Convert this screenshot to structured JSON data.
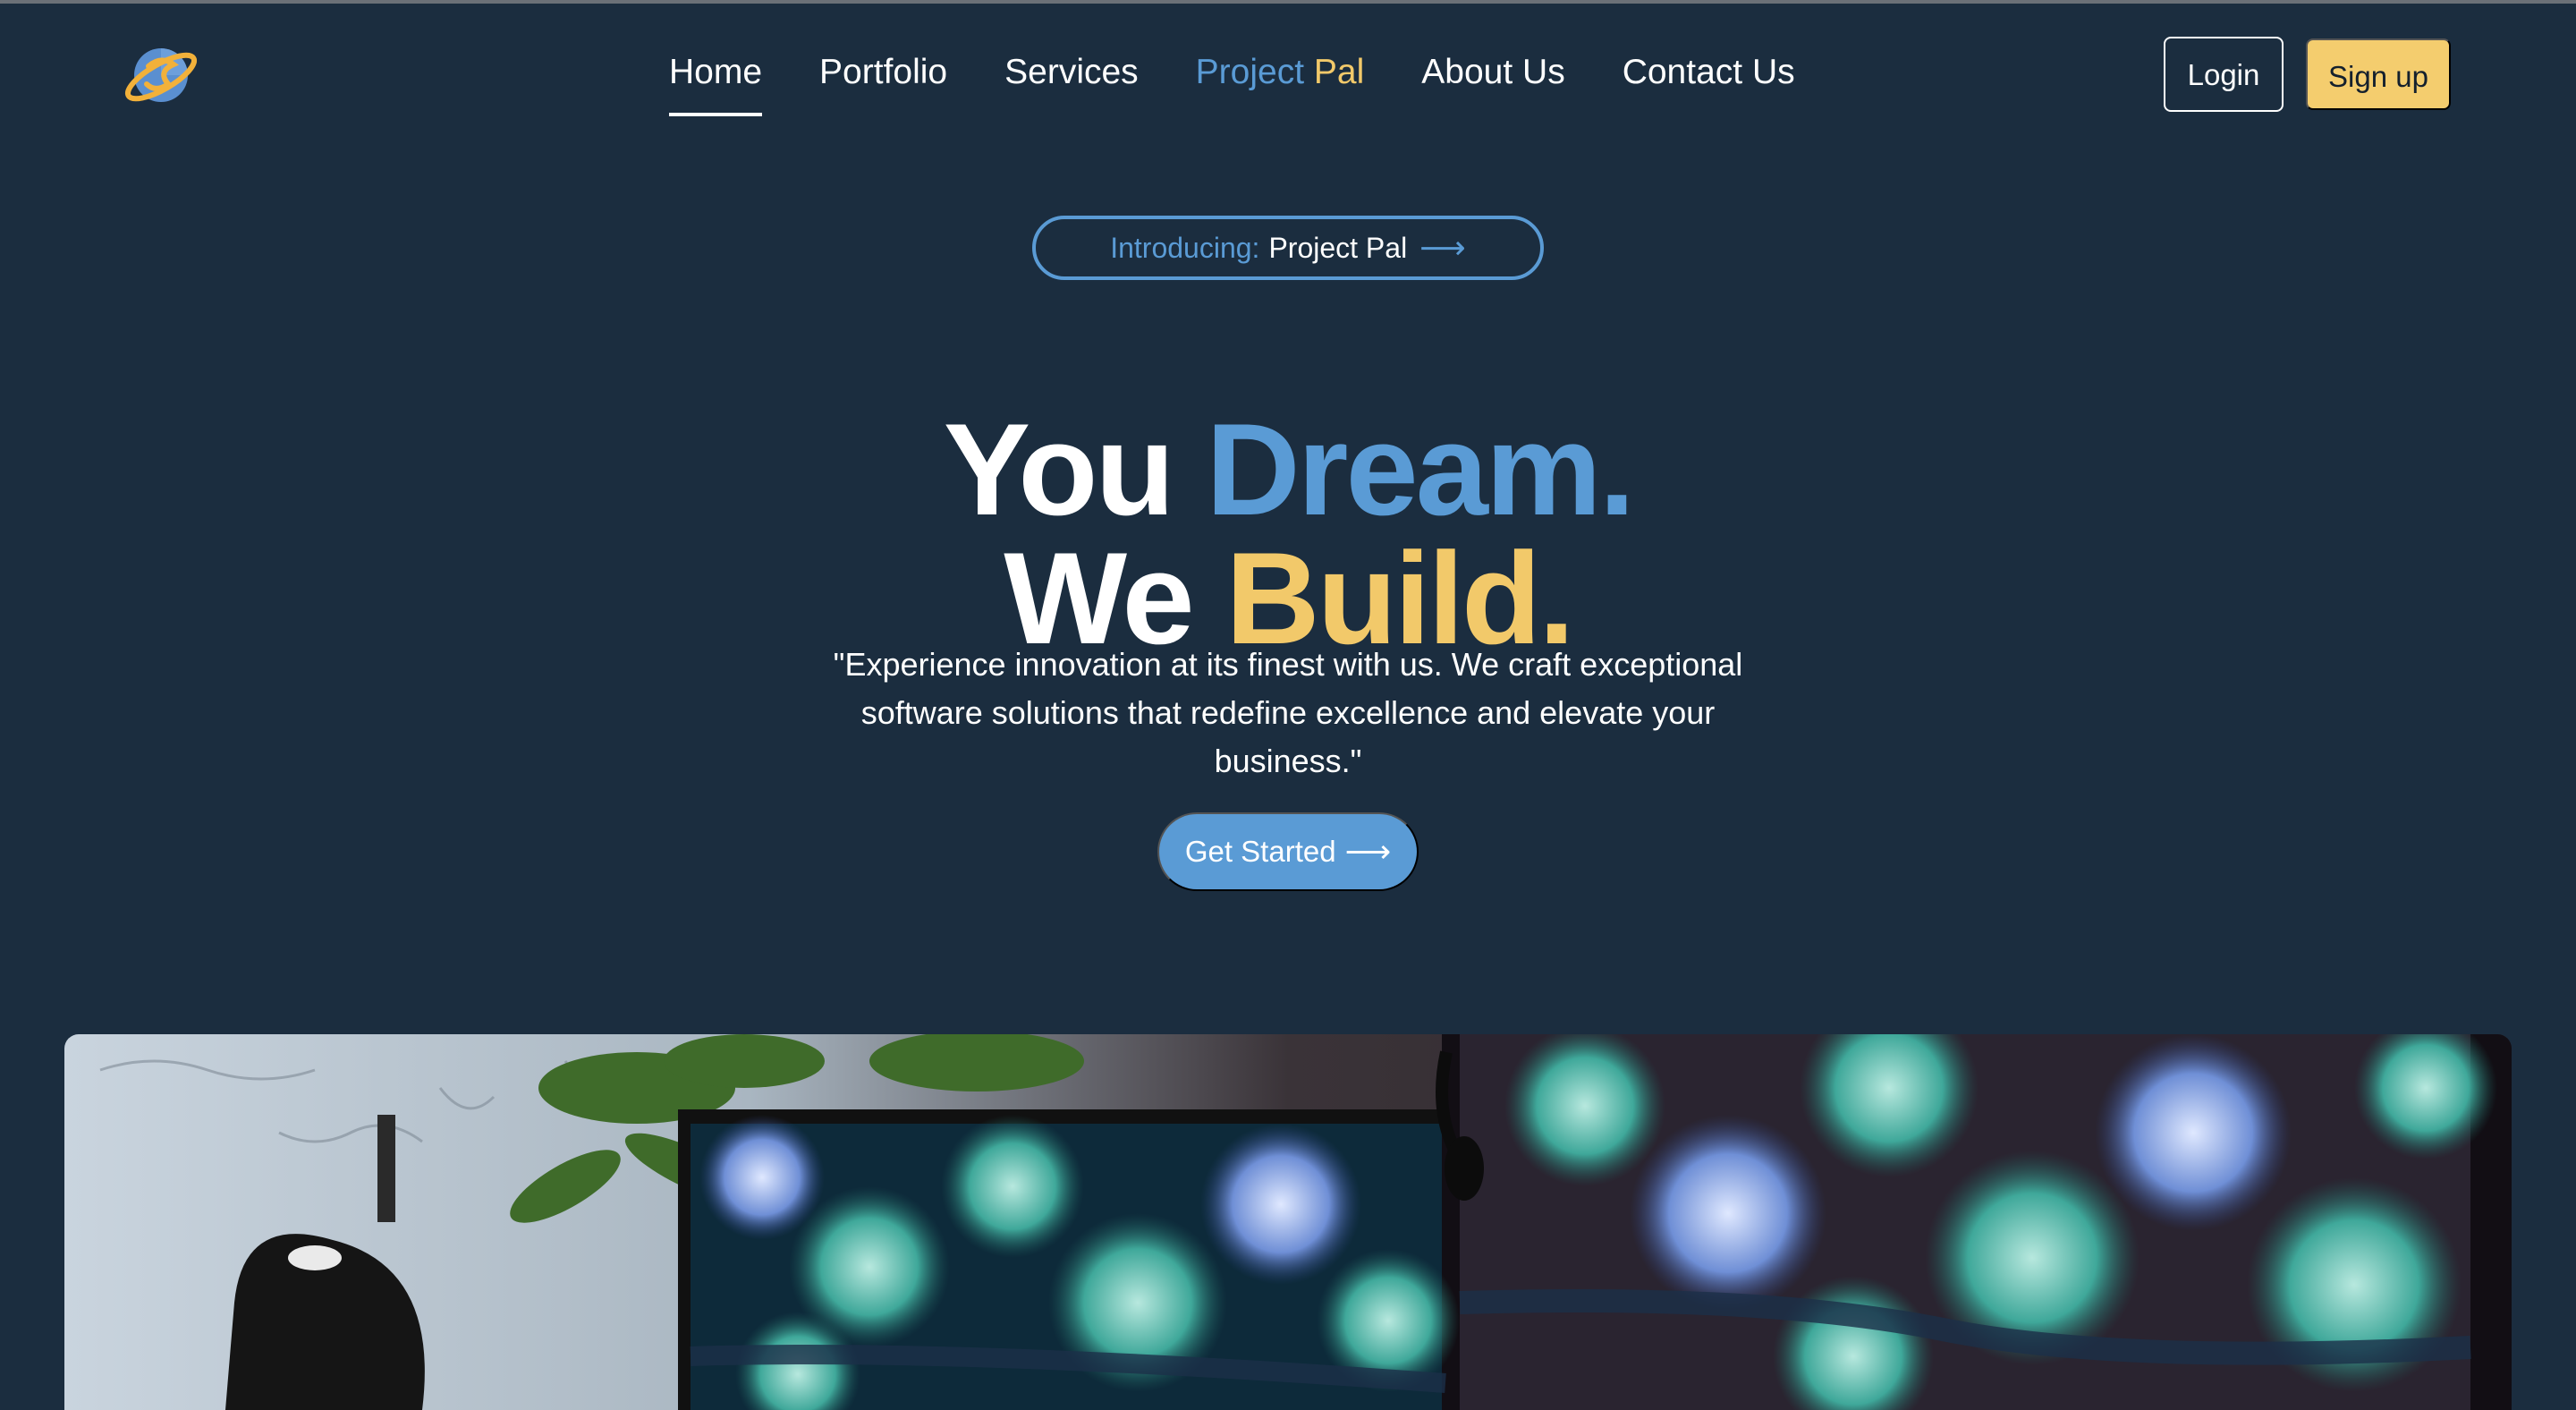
{
  "nav": {
    "items": [
      {
        "label": "Home",
        "active": true
      },
      {
        "label": "Portfolio"
      },
      {
        "label": "Services"
      },
      {
        "label": "Project Pal",
        "part_a": "Project",
        "part_b": "Pal"
      },
      {
        "label": "About Us"
      },
      {
        "label": "Contact Us"
      }
    ],
    "login_label": "Login",
    "signup_label": "Sign up"
  },
  "hero": {
    "pill": {
      "intro": "Introducing:",
      "name": "Project Pal",
      "arrow": "⟶"
    },
    "headline": {
      "line1_a": "You",
      "line1_b": "Dream.",
      "line2_a": "We",
      "line2_b": "Build."
    },
    "lead": "\"Experience innovation at its finest with us. We craft exceptional software solutions that redefine excellence and elevate your business.\"",
    "cta_label": "Get Started",
    "cta_arrow": "⟶"
  },
  "colors": {
    "background": "#1b2d3f",
    "accent_blue": "#5a9bd5",
    "accent_gold": "#f2c96a",
    "signup_bg": "#f4cd6e"
  },
  "icons": {
    "logo": "planet-logo-icon",
    "arrow": "arrow-right-icon"
  }
}
